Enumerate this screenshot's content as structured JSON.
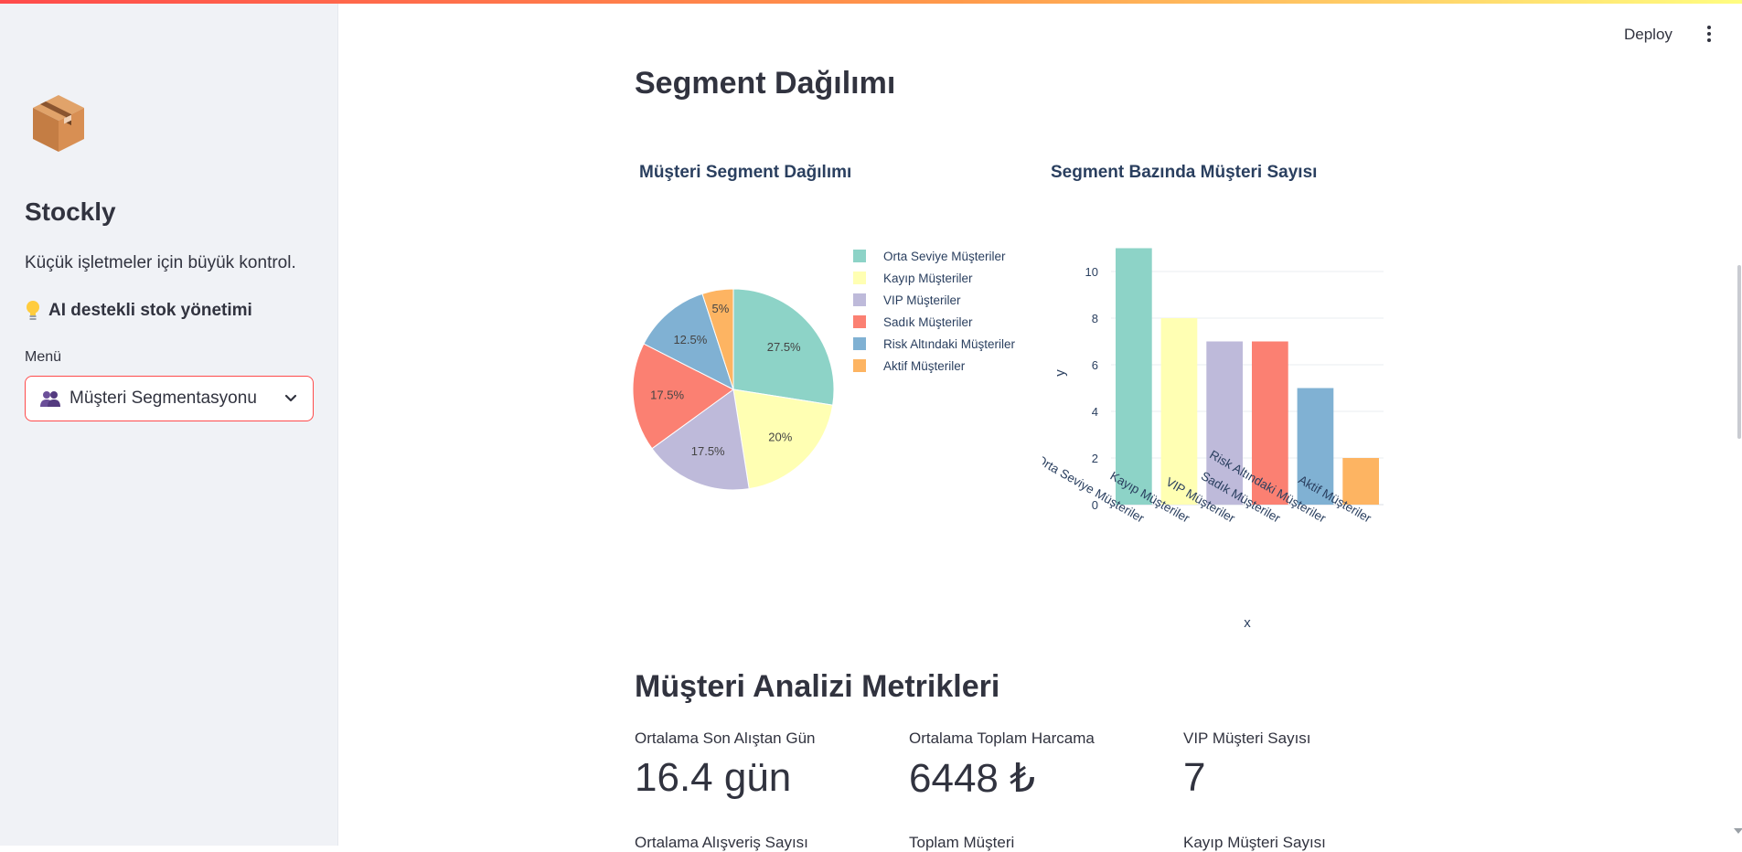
{
  "sidebar": {
    "brand": "Stockly",
    "tagline": "Küçük işletmeler için büyük kontrol.",
    "ai_line": "AI destekli stok yönetimi",
    "menu_label": "Menü",
    "menu_selected": "Müşteri Segmentasyonu"
  },
  "header": {
    "deploy_label": "Deploy"
  },
  "main": {
    "section1_title": "Segment Dağılımı",
    "section2_title": "Müşteri Analizi Metrikleri",
    "metrics": [
      {
        "label": "Ortalama Son Alıştan Gün",
        "value": "16.4 gün"
      },
      {
        "label": "Ortalama Toplam Harcama",
        "value": "6448 ₺"
      },
      {
        "label": "VIP Müşteri Sayısı",
        "value": "7"
      },
      {
        "label": "Ortalama Alışveriş Sayısı",
        "value": ""
      },
      {
        "label": "Toplam Müşteri",
        "value": ""
      },
      {
        "label": "Kayıp Müşteri Sayısı",
        "value": ""
      }
    ]
  },
  "colors": {
    "accent": "#ff4b4b",
    "sidebar_bg": "#f0f2f6",
    "series": [
      "#8dd3c7",
      "#ffffb3",
      "#bebada",
      "#fb8072",
      "#80b1d3",
      "#fdb462"
    ]
  },
  "chart_data": [
    {
      "type": "pie",
      "title": "Müşteri Segment Dağılımı",
      "labels": [
        "Orta Seviye Müşteriler",
        "Kayıp Müşteriler",
        "VIP Müşteriler",
        "Sadık Müşteriler",
        "Risk Altındaki Müşteriler",
        "Aktif Müşteriler"
      ],
      "values": [
        27.5,
        20,
        17.5,
        17.5,
        12.5,
        5
      ],
      "value_labels": [
        "27.5%",
        "20%",
        "17.5%",
        "17.5%",
        "12.5%",
        "5%"
      ],
      "legend": "right"
    },
    {
      "type": "bar",
      "title": "Segment Bazında Müşteri Sayısı",
      "categories": [
        "Orta Seviye Müşteriler",
        "Kayıp Müşteriler",
        "VIP Müşteriler",
        "Sadık Müşteriler",
        "Risk Altındaki Müşteriler",
        "Aktif Müşteriler"
      ],
      "values": [
        11,
        8,
        7,
        7,
        5,
        2
      ],
      "xlabel": "x",
      "ylabel": "y",
      "ylim": [
        0,
        11
      ],
      "yticks": [
        "0",
        "2",
        "4",
        "6",
        "8",
        "10"
      ],
      "grid": true
    }
  ]
}
